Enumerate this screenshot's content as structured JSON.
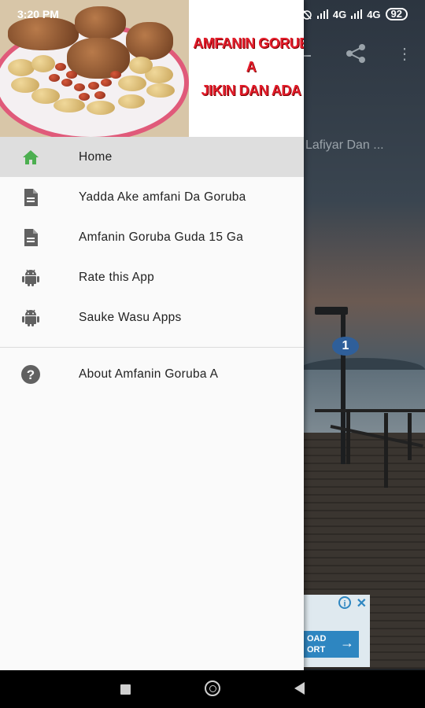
{
  "status_bar": {
    "time": "3:20 PM",
    "dots": "...",
    "network_1": "4G",
    "network_2": "4G",
    "battery": "92"
  },
  "background": {
    "content_text": "Lafiyar Dan ...",
    "ad_button_text": "OAD\nORT",
    "ad_info_label": "i",
    "ad_close_label": "✕",
    "ad_arrow": "→"
  },
  "drawer": {
    "header": {
      "title_lines": [
        "AMFANIN GORUB",
        "A",
        "JIKIN DAN ADA"
      ]
    },
    "items": [
      {
        "label": "Home",
        "icon": "home-icon",
        "active": true,
        "icon_color": "#4caf50"
      },
      {
        "label": "Yadda Ake amfani Da Goruba",
        "icon": "document-icon",
        "active": false
      },
      {
        "label": "Amfanin Goruba Guda 15 Ga",
        "icon": "document-icon",
        "active": false
      },
      {
        "label": "Rate this App",
        "icon": "android-icon",
        "active": false
      },
      {
        "label": "Sauke Wasu Apps",
        "icon": "android-icon",
        "active": false
      }
    ],
    "footer_items": [
      {
        "label": "About Amfanin Goruba A",
        "icon": "help-icon"
      }
    ]
  },
  "colors": {
    "accent_green": "#4caf50",
    "icon_gray": "#616161",
    "header_title_red": "#e31d2b",
    "active_row": "#dedede"
  }
}
